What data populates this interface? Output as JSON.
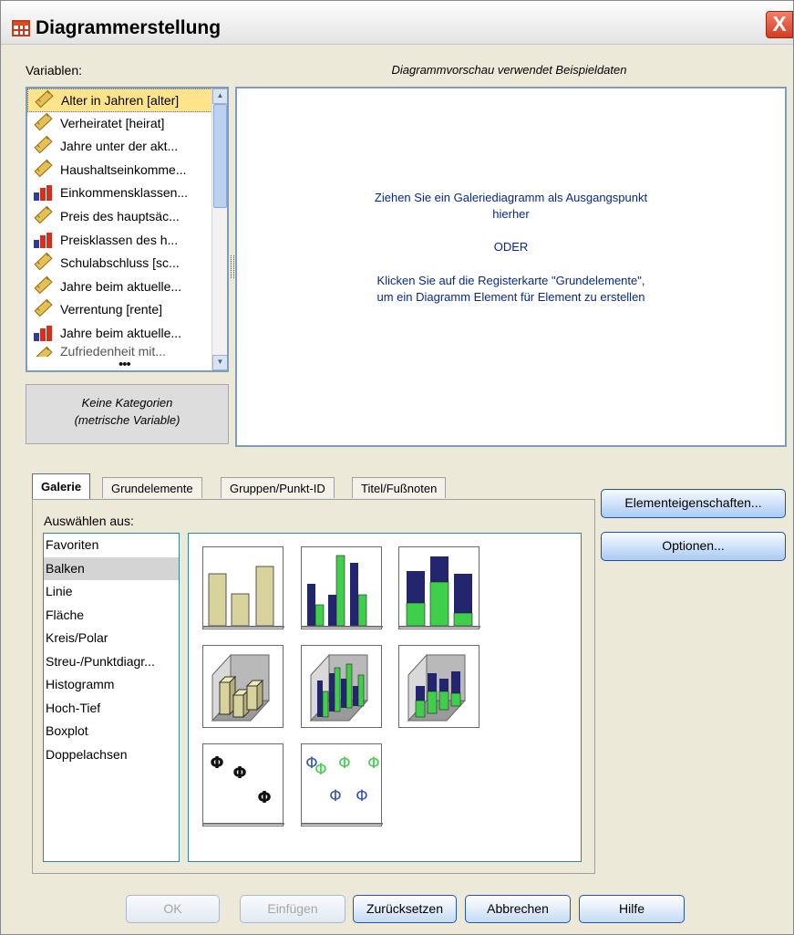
{
  "window": {
    "title": "Diagrammerstellung",
    "close_label": "X"
  },
  "variables": {
    "label": "Variablen:",
    "items": [
      {
        "label": "Alter in Jahren [alter]",
        "icon": "scale-ruler-icon",
        "selected": true
      },
      {
        "label": "Verheiratet [heirat]",
        "icon": "scale-ruler-icon"
      },
      {
        "label": "Jahre unter der akt...",
        "icon": "scale-ruler-icon"
      },
      {
        "label": "Haushaltseinkomme...",
        "icon": "scale-ruler-icon"
      },
      {
        "label": "Einkommensklassen...",
        "icon": "ordinal-bars-icon"
      },
      {
        "label": "Preis des hauptsäc...",
        "icon": "scale-ruler-icon"
      },
      {
        "label": "Preisklassen des h...",
        "icon": "ordinal-bars-icon"
      },
      {
        "label": "Schulabschluss [sc...",
        "icon": "scale-ruler-icon"
      },
      {
        "label": "Jahre beim aktuelle...",
        "icon": "scale-ruler-icon"
      },
      {
        "label": "Verrentung [rente]",
        "icon": "scale-ruler-icon"
      },
      {
        "label": "Jahre beim aktuelle...",
        "icon": "ordinal-bars-icon"
      }
    ],
    "partial_item": "Zufriedenheit mit..."
  },
  "category_box": {
    "line1": "Keine Kategorien",
    "line2": "(metrische Variable)"
  },
  "preview": {
    "title": "Diagrammvorschau verwendet Beispieldaten",
    "line1": "Ziehen Sie ein Galeriediagramm als Ausgangspunkt",
    "line2": "hierher",
    "line3": "ODER",
    "line4": "Klicken Sie auf die Registerkarte \"Grundelemente\",",
    "line5": "um ein Diagramm Element für Element zu erstellen"
  },
  "tabs": [
    {
      "label": "Galerie",
      "active": true
    },
    {
      "label": "Grundelemente"
    },
    {
      "label": "Gruppen/Punkt-ID"
    },
    {
      "label": "Titel/Fußnoten"
    }
  ],
  "gallery": {
    "choose_from_label": "Auswählen aus:",
    "types": [
      "Favoriten",
      "Balken",
      "Linie",
      "Fläche",
      "Kreis/Polar",
      "Streu-/Punktdiagr...",
      "Histogramm",
      "Hoch-Tief",
      "Boxplot",
      "Doppelachsen"
    ],
    "selected_type": "Balken",
    "thumbnails": [
      "simple-bar-chart-icon",
      "clustered-bar-chart-icon",
      "stacked-bar-chart-icon",
      "3d-simple-bar-icon",
      "3d-clustered-bar-icon",
      "3d-stacked-bar-icon",
      "simple-error-bar-icon",
      "clustered-error-bar-icon"
    ]
  },
  "side_buttons": {
    "element_properties": "Elementeigenschaften...",
    "options": "Optionen..."
  },
  "footer": {
    "ok": "OK",
    "paste": "Einfügen",
    "reset": "Zurücksetzen",
    "cancel": "Abbrechen",
    "help": "Hilfe"
  },
  "colors": {
    "bar_tan": "#d8d29c",
    "bar_navy": "#23266e",
    "bar_green": "#3fcf4a",
    "error_blue": "#3855b4",
    "title_text_blue": "#07288f"
  }
}
